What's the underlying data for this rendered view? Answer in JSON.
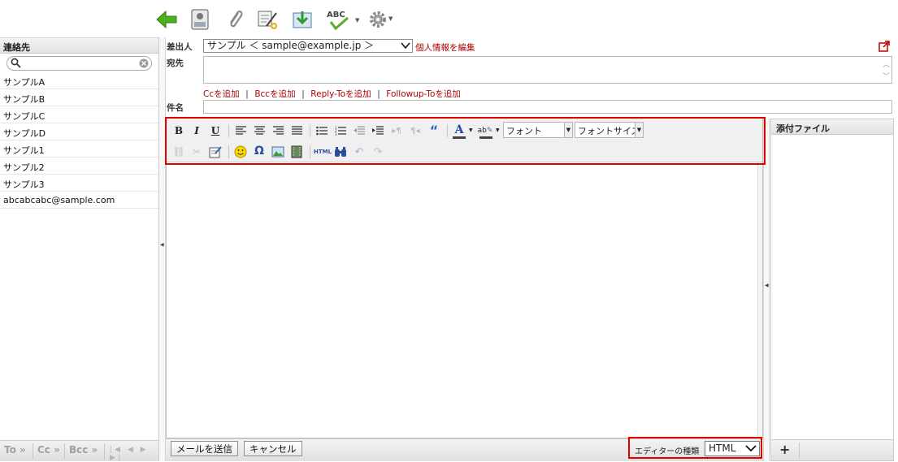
{
  "toolbar": {
    "icons": [
      "back-arrow-icon",
      "address-book-icon",
      "paperclip-icon",
      "signature-icon",
      "save-draft-icon",
      "spellcheck-icon",
      "settings-gear-icon"
    ],
    "spellcheck_label": "ABC"
  },
  "contacts": {
    "header": "連絡先",
    "search_value": "",
    "items": [
      "サンプルA",
      "サンプルB",
      "サンプルC",
      "サンプルD",
      "サンプル1",
      "サンプル2",
      "サンプル3",
      "abcabcabc@sample.com"
    ],
    "footer": {
      "to": "To »",
      "cc": "Cc »",
      "bcc": "Bcc »"
    }
  },
  "compose": {
    "sender_label": "差出人",
    "sender_value": "サンプル ＜ sample@example.jp ＞",
    "edit_identity_link": "個人情報を編集",
    "to_label": "宛先",
    "to_value": "",
    "add_links": [
      "Ccを追加",
      "Bccを追加",
      "Reply-Toを追加",
      "Followup-Toを追加"
    ],
    "subject_label": "件名",
    "subject_value": ""
  },
  "editor": {
    "font_select": "フォント",
    "font_size_select": "フォントサイズ",
    "html_source_label": "HTML",
    "body": ""
  },
  "bottom": {
    "send_button": "メールを送信",
    "cancel_button": "キャンセル",
    "editor_type_label": "エディターの種類",
    "editor_type_value": "HTML"
  },
  "attachments": {
    "header": "添付ファイル",
    "add_label": "+"
  },
  "colors": {
    "accent_red": "#e00000",
    "link_red": "#b00000",
    "back_arrow_green": "#4caf1e"
  }
}
